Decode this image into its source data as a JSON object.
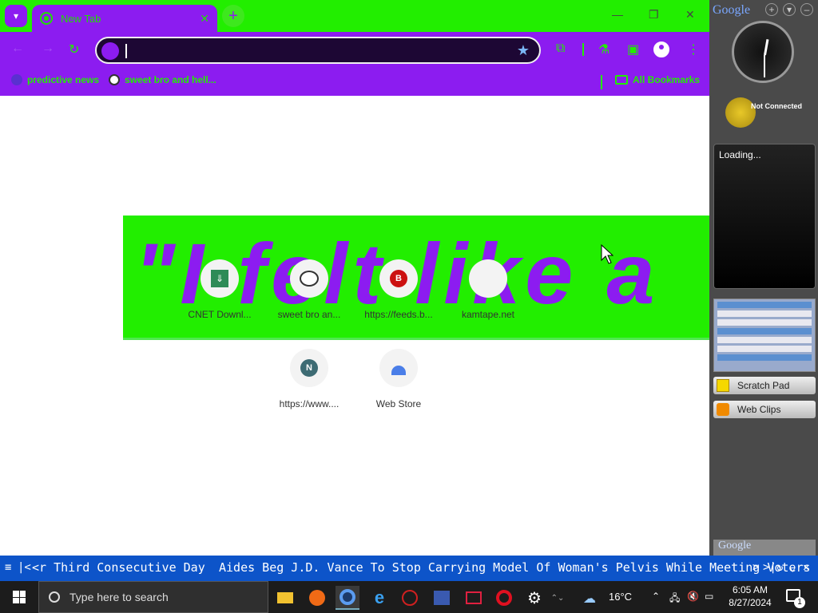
{
  "browser": {
    "tab_title": "New Tab",
    "bookmarks": [
      {
        "label": "predictive news"
      },
      {
        "label": "sweet bro and hell..."
      }
    ],
    "all_bookmarks": "All Bookmarks",
    "omnibox_value": ""
  },
  "ntp": {
    "banner_text": "\"I felt like a",
    "shortcuts": [
      {
        "label": "CNET Downl..."
      },
      {
        "label": "sweet bro an..."
      },
      {
        "label": "https://feeds.b..."
      },
      {
        "label": "kamtape.net"
      },
      {
        "label": "https://www...."
      },
      {
        "label": "Web Store"
      }
    ],
    "shortcut_icon_letters": [
      "B",
      "N"
    ]
  },
  "sidebar": {
    "title": "Google",
    "weather_status": "Not Connected",
    "loading": "Loading...",
    "items": [
      {
        "label": "Scratch Pad"
      },
      {
        "label": "Web Clips"
      }
    ],
    "footer": "Google"
  },
  "ticker": {
    "story_1": "<r Third Consecutive Day",
    "story_2": "Aides Beg J.D. Vance To Stop Carrying Model Of Woman's Pelvis While Meeting Voters"
  },
  "taskbar": {
    "search_placeholder": "Type here to search",
    "weather": "16°C",
    "time": "6:05 AM",
    "date": "8/27/2024",
    "notification_count": "1"
  },
  "colors": {
    "accent_green": "#22ee00",
    "accent_purple": "#8c1cf0",
    "ticker_blue": "#0d54c9"
  }
}
